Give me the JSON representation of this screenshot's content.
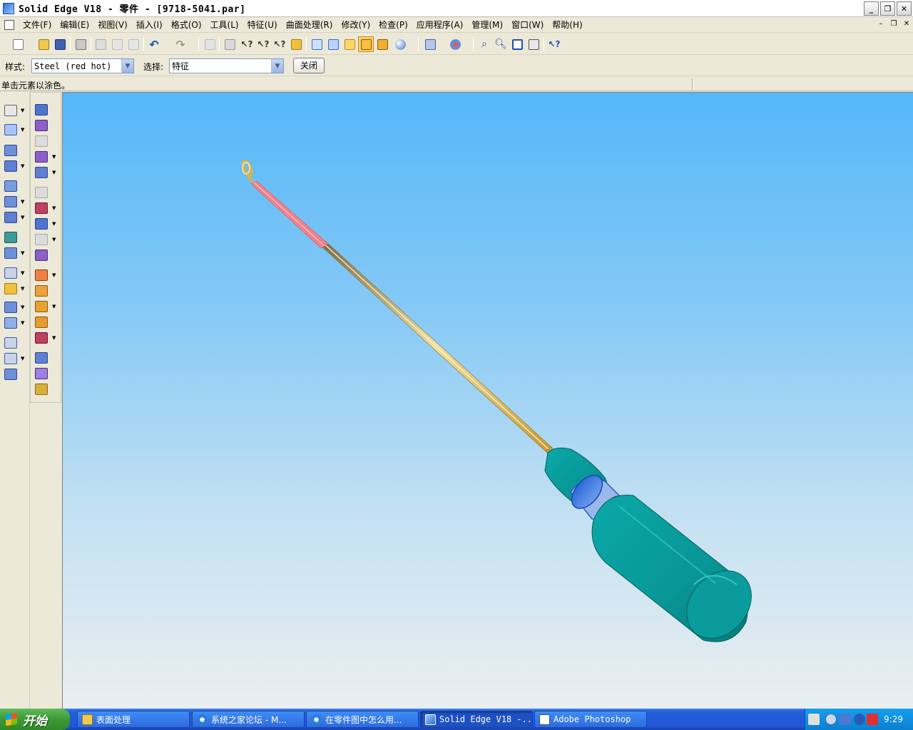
{
  "window": {
    "title": "Solid Edge V18 - 零件 - [9718-5041.par]",
    "caption_buttons": [
      "minimize-icon",
      "restore-icon",
      "close-icon"
    ]
  },
  "menu": {
    "items": [
      "文件(F)",
      "编辑(E)",
      "视图(V)",
      "插入(I)",
      "格式(O)",
      "工具(L)",
      "特征(U)",
      "曲面处理(R)",
      "修改(Y)",
      "检查(P)",
      "应用程序(A)",
      "管理(M)",
      "窗口(W)",
      "帮助(H)"
    ]
  },
  "ribbon": {
    "style_label": "样式:",
    "style_value": "Steel (red hot)",
    "select_label": "选择:",
    "select_value": "特征",
    "close_button": "关闭"
  },
  "prompt": {
    "text": "单击元素以涂色。"
  },
  "colors": {
    "viewport_top": "#55b7f8",
    "viewport_bottom": "#eaeef0",
    "handle": "#0f9a9a",
    "shaft_gold": "#d8b24a",
    "shaft_red_hot": "#f07a80",
    "active_tool": "#ffcf6e"
  },
  "taskbar": {
    "start_label": "开始",
    "tasks": [
      {
        "label": "表面处理",
        "icon": "folder-icon"
      },
      {
        "label": "系统之家论坛 - M...",
        "icon": "ie-icon"
      },
      {
        "label": "在零件图中怎么用...",
        "icon": "ie-icon"
      },
      {
        "label": "Solid Edge V18 -...",
        "icon": "solid-edge-icon",
        "active": true
      },
      {
        "label": "Adobe Photoshop",
        "icon": "photoshop-icon"
      }
    ],
    "clock": "9:29"
  }
}
